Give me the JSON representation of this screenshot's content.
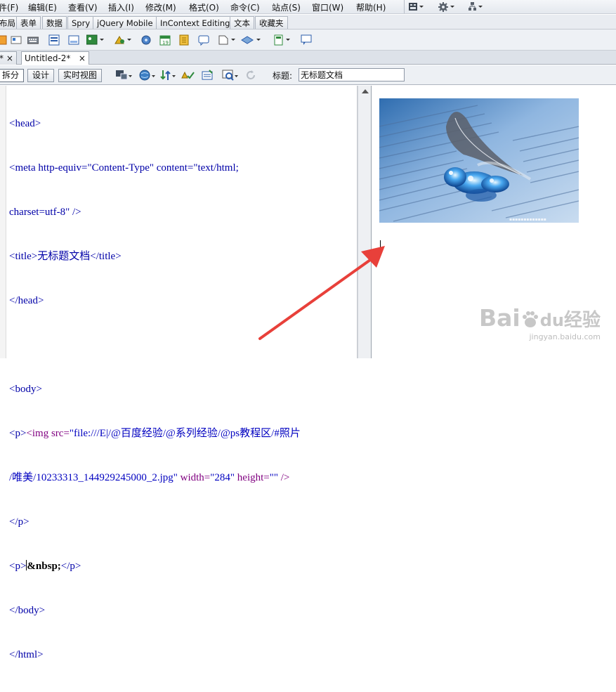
{
  "menu": [
    {
      "label": "件(F)"
    },
    {
      "label": "编辑(E)"
    },
    {
      "label": "查看(V)"
    },
    {
      "label": "插入(I)"
    },
    {
      "label": "修改(M)"
    },
    {
      "label": "格式(O)"
    },
    {
      "label": "命令(C)"
    },
    {
      "label": "站点(S)"
    },
    {
      "label": "窗口(W)"
    },
    {
      "label": "帮助(H)"
    }
  ],
  "insert_tabs": [
    "布局",
    "表单",
    "数据",
    "Spry",
    "jQuery Mobile",
    "InContext Editing",
    "文本",
    "收藏夹"
  ],
  "doc_tabs": [
    {
      "label": "*",
      "close": "×"
    },
    {
      "label": "Untitled-2*",
      "close": "×"
    }
  ],
  "view_buttons": {
    "split": "拆分",
    "design": "设计",
    "live": "实时视图"
  },
  "title_field": {
    "label": "标题:",
    "value": "无标题文档"
  },
  "code_lines": [
    [
      "<head>"
    ],
    [
      "<meta http-equiv=\"Content-Type\" content=\"text/html;"
    ],
    [
      "charset=utf-8\" />"
    ],
    [
      "<title>无标题文档</title>"
    ],
    [
      "</head>"
    ],
    [
      ""
    ],
    [
      "<body>"
    ],
    [
      "<p><img src=\"file:///E|/@百度经验/@系列经验/@ps教程区/#照片"
    ],
    [
      "/唯美/10233313_144929245000_2.jpg\" width=\"284\" height=\"\" />"
    ],
    [
      "</p>"
    ],
    [
      "<p>&nbsp;</p>"
    ],
    [
      "</body>"
    ],
    [
      "</html>"
    ]
  ],
  "code_tokens": {
    "l7_a": "<p>",
    "l7_b": "<img src=",
    "l7_c": "\"file:///E|/@百度经验/@系列经验/@ps教程区/#照片",
    "l8_a": "/唯美/10233313_144929245000_2.jpg\"",
    "l8_b": " width=",
    "l8_c": "\"284\"",
    "l8_d": " height=",
    "l8_e": "\"\"",
    "l8_f": " />",
    "l10_a": "<p>",
    "l10_b": "&nbsp;",
    "l10_c": "</p>"
  },
  "watermark": {
    "line1": "Bai",
    "paw": "du",
    "cn": "经验",
    "line2": "jingyan.baidu.com"
  },
  "colors": {
    "tag": "#0000a8",
    "attr": "#800080",
    "arrow": "#e8403a"
  }
}
